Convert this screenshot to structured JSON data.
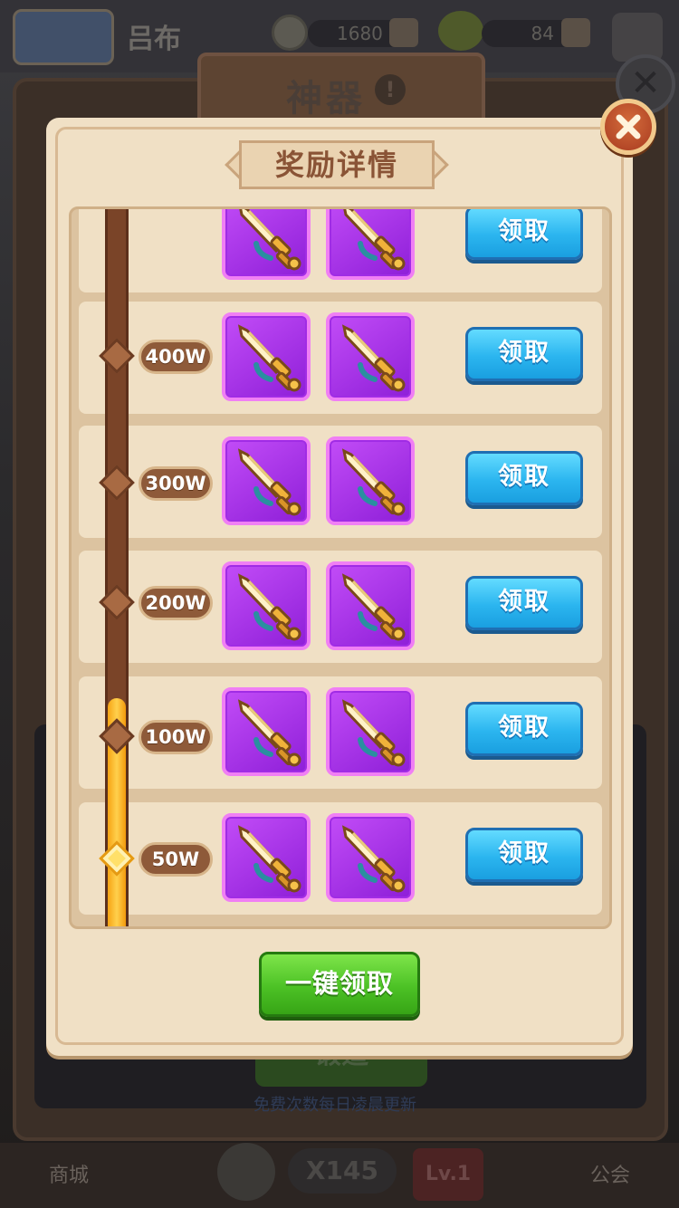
{
  "background": {
    "player_name": "吕布",
    "gold": "1680",
    "gems": "84",
    "title": "神器",
    "title_mark": "!",
    "forge_label": "锻造",
    "forge_note": "免费次数每日凌晨更新",
    "bottom_left": "商城",
    "bottom_right": "公会",
    "count": "X145",
    "level": "Lv.1"
  },
  "modal": {
    "title": "奖励详情",
    "claim_all_label": "一键领取",
    "colors": {
      "claim_button": "#2bb5ef",
      "claim_all_button": "#4cc125",
      "item_frame": "#a02ce5",
      "progress_fill": "#ffd04d"
    },
    "tiers": [
      {
        "label": "",
        "reward_icons": [
          "sword-icon",
          "sword-icon"
        ],
        "button": "领取",
        "reached": false
      },
      {
        "label": "400W",
        "reward_icons": [
          "sword-icon",
          "sword-icon"
        ],
        "button": "领取",
        "reached": false
      },
      {
        "label": "300W",
        "reward_icons": [
          "sword-icon",
          "sword-icon"
        ],
        "button": "领取",
        "reached": false
      },
      {
        "label": "200W",
        "reward_icons": [
          "sword-icon",
          "sword-icon"
        ],
        "button": "领取",
        "reached": false
      },
      {
        "label": "100W",
        "reward_icons": [
          "sword-icon",
          "sword-icon"
        ],
        "button": "领取",
        "reached": false
      },
      {
        "label": "50W",
        "reward_icons": [
          "sword-icon",
          "sword-icon"
        ],
        "button": "领取",
        "reached": true
      }
    ]
  }
}
